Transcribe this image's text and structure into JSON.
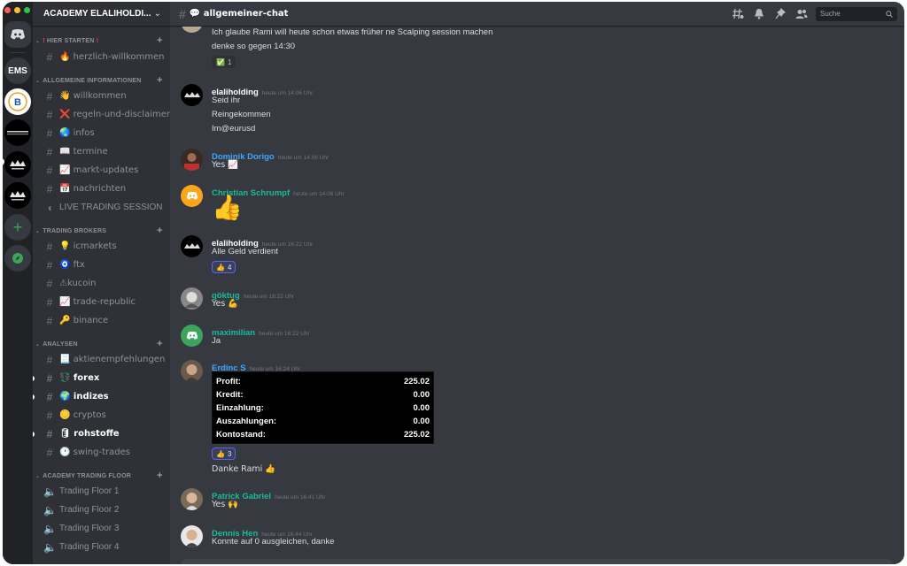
{
  "rail": {
    "servers": [
      {
        "name": "discord-home",
        "label": ""
      },
      {
        "name": "ems",
        "label": "EMS"
      },
      {
        "name": "server-b",
        "label": ""
      },
      {
        "name": "elali-trading",
        "label": ""
      },
      {
        "name": "server-academy-1",
        "label": ""
      },
      {
        "name": "server-academy-2",
        "label": ""
      }
    ]
  },
  "sidebar": {
    "server_name": "ACADEMY ELALIHOLDI...",
    "categories": [
      {
        "name": "HIER STARTEN",
        "channels": [
          {
            "label": "🔥 herzlich-willkommen"
          }
        ]
      },
      {
        "name": "ALLGEMEINE INFORMATIONEN",
        "channels": [
          {
            "label": "👋 willkommen"
          },
          {
            "label": "❌ regeln-und-disclaimer"
          },
          {
            "label": "🌏 infos"
          },
          {
            "label": "📖 termine"
          },
          {
            "label": "📈 markt-updates"
          },
          {
            "label": "📅 nachrichten"
          },
          {
            "label": "LIVE TRADING SESSION"
          }
        ]
      },
      {
        "name": "TRADING BROKERS",
        "channels": [
          {
            "label": "💡 icmarkets"
          },
          {
            "label": "🧿 ftx"
          },
          {
            "label": "⚠kucoin"
          },
          {
            "label": "📈 trade-republic"
          },
          {
            "label": "🔑 binance"
          }
        ]
      },
      {
        "name": "ANALYSEN",
        "channels": [
          {
            "label": "📃 aktienempfehlungen"
          },
          {
            "label": "💱 forex"
          },
          {
            "label": "🌍 indizes"
          },
          {
            "label": "🪙 cryptos"
          },
          {
            "label": "🛢 rohstoffe"
          },
          {
            "label": "🕐 swing-trades"
          }
        ]
      },
      {
        "name": "ACADEMY TRADING FLOOR",
        "channels": [
          {
            "label": "Trading Floor 1"
          },
          {
            "label": "Trading Floor 2"
          },
          {
            "label": "Trading Floor 3"
          },
          {
            "label": "Trading Floor 4"
          }
        ]
      }
    ]
  },
  "channel": {
    "title": "💬 allgemeiner-chat",
    "search_placeholder": "Suche"
  },
  "messages": [
    {
      "lines": [
        "Ich glaube Rami will heute schon etwas früher ne Scalping session machen",
        "denke so gegen 14:30"
      ],
      "reaction": {
        "emoji": "✅",
        "count": "1"
      }
    },
    {
      "user": "elaliholding",
      "time": "heute um 14:06 Uhr",
      "color": "#ffffff",
      "lines": [
        "Seid ihr",
        "Reingekommen",
        "Im@eurusd"
      ]
    },
    {
      "user": "Dominik Dorigo",
      "time": "heute um 14:06 Uhr",
      "color": "#3ea6ff",
      "lines": [
        "Yes 📈"
      ]
    },
    {
      "user": "Christian Schrumpf",
      "time": "heute um 14:06 Uhr",
      "color": "#1abc9c",
      "big_emoji": "👍"
    },
    {
      "user": "elaliholding",
      "time": "heute um 16:22 Uhr",
      "color": "#ffffff",
      "lines": [
        "Alle Geld verdient"
      ],
      "reaction": {
        "emoji": "👍",
        "count": "4"
      }
    },
    {
      "user": "göktug",
      "time": "heute um 16:22 Uhr",
      "color": "#1abc9c",
      "lines": [
        "Yes 💪"
      ]
    },
    {
      "user": "maximilian",
      "time": "heute um 16:22 Uhr",
      "color": "#1abc9c",
      "lines": [
        "Ja"
      ]
    },
    {
      "user": "Erdinc S",
      "time": "heute um 16:24 Uhr",
      "color": "#3ea6ff",
      "table": [
        {
          "label": "Profit:",
          "value": "225.02"
        },
        {
          "label": "Kredit:",
          "value": "0.00"
        },
        {
          "label": "Einzahlung:",
          "value": "0.00"
        },
        {
          "label": "Auszahlungen:",
          "value": "0.00"
        },
        {
          "label": "Kontostand:",
          "value": "225.02"
        }
      ],
      "reaction": {
        "emoji": "👍",
        "count": "3"
      },
      "after": "Danke Rami 👍"
    },
    {
      "user": "Patrick Gabriel",
      "time": "heute um 16:41 Uhr",
      "color": "#1abc9c",
      "lines": [
        "Yes 🙌"
      ]
    },
    {
      "user": "Dennis Hen",
      "time": "heute um 16:44 Uhr",
      "color": "#1abc9c",
      "lines": [
        "Konnte auf 0 ausgleichen, danke"
      ]
    }
  ],
  "colors": {
    "accent": "#5865f2",
    "green": "#3ba55d",
    "red": "#ed4245"
  }
}
